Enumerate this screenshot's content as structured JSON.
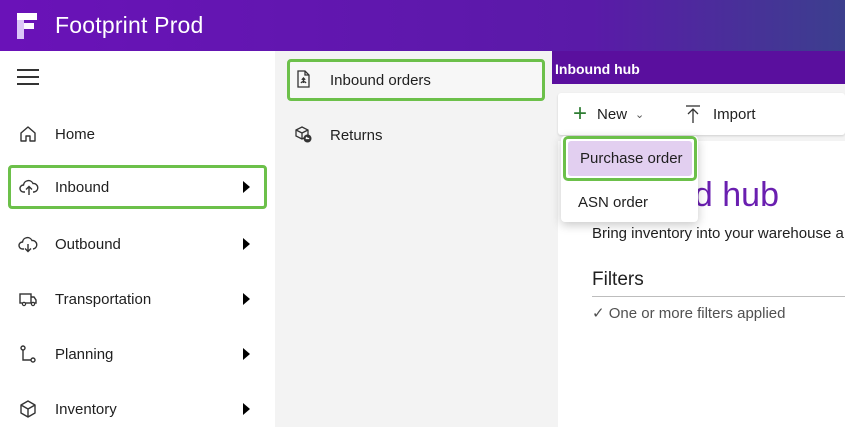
{
  "app": {
    "title": "Footprint Prod",
    "brand_color": "#6a12b8",
    "accent_green": "#6cc04a"
  },
  "leftnav": {
    "menu_icon": "hamburger-icon",
    "items": [
      {
        "label": "Home",
        "icon": "home-icon",
        "has_submenu": false
      },
      {
        "label": "Inbound",
        "icon": "inbound-icon",
        "has_submenu": true,
        "selected": true
      },
      {
        "label": "Outbound",
        "icon": "outbound-icon",
        "has_submenu": true
      },
      {
        "label": "Transportation",
        "icon": "truck-icon",
        "has_submenu": true
      },
      {
        "label": "Planning",
        "icon": "planning-icon",
        "has_submenu": true
      },
      {
        "label": "Inventory",
        "icon": "box-icon",
        "has_submenu": true
      }
    ]
  },
  "subnav": {
    "items": [
      {
        "label": "Inbound orders",
        "icon": "inbound-orders-icon",
        "selected": true
      },
      {
        "label": "Returns",
        "icon": "returns-icon"
      }
    ]
  },
  "content": {
    "header": "Inbound hub",
    "toolbar": {
      "new_label": "New",
      "import_label": "Import"
    },
    "dropdown": {
      "options": [
        "Purchase order",
        "ASN order"
      ]
    },
    "title_visible": "nd hub",
    "description": "Bring inventory into your warehouse a",
    "filters": {
      "title": "Filters",
      "status": "✓ One or more filters applied"
    }
  }
}
